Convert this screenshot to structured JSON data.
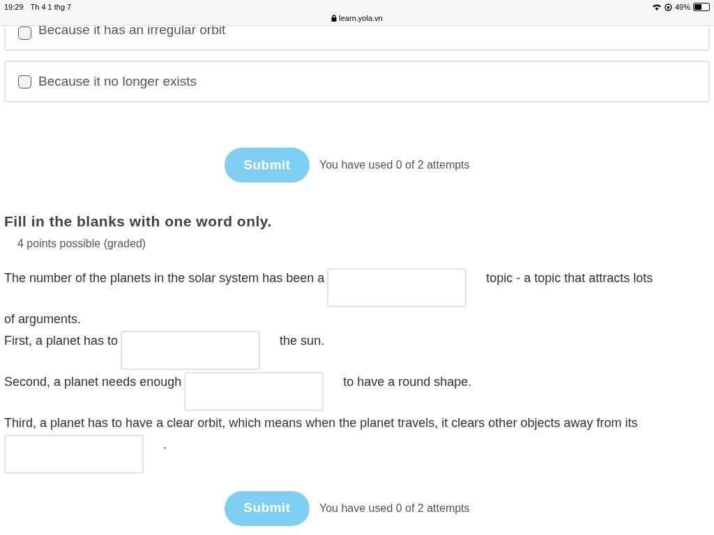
{
  "status_bar": {
    "time": "19:29",
    "date": "Th 4 1 thg 7",
    "url": "learn.yola.vn",
    "battery": "49%"
  },
  "options": [
    {
      "label": "Because it has an irregular orbit",
      "checked": false
    },
    {
      "label": "Because it no longer exists",
      "checked": false
    }
  ],
  "submit_1": {
    "label": "Submit",
    "attempts": "You have used 0 of 2 attempts"
  },
  "question": {
    "title": "Fill in the blanks with one word only.",
    "points": "4 points possible (graded)",
    "sentences": [
      [
        {
          "kind": "text",
          "text": "The number of the planets in the solar system has been a"
        },
        {
          "kind": "blank"
        },
        {
          "kind": "text",
          "text": "topic - a topic that attracts lots"
        },
        {
          "kind": "break"
        },
        {
          "kind": "text",
          "text": "of arguments."
        }
      ],
      [
        {
          "kind": "text",
          "text": "First, a planet has to"
        },
        {
          "kind": "blank"
        },
        {
          "kind": "text",
          "text": "the sun."
        }
      ],
      [
        {
          "kind": "text",
          "text": "Second, a planet needs enough"
        },
        {
          "kind": "blank"
        },
        {
          "kind": "text",
          "text": "to have a round shape."
        }
      ],
      [
        {
          "kind": "text",
          "text": "Third, a planet has to have a clear orbit, which means when the planet travels, it clears other objects away from its"
        },
        {
          "kind": "blank"
        },
        {
          "kind": "text",
          "text": "."
        }
      ]
    ]
  },
  "submit_2": {
    "label": "Submit",
    "attempts": "You have used 0 of 2 attempts"
  }
}
